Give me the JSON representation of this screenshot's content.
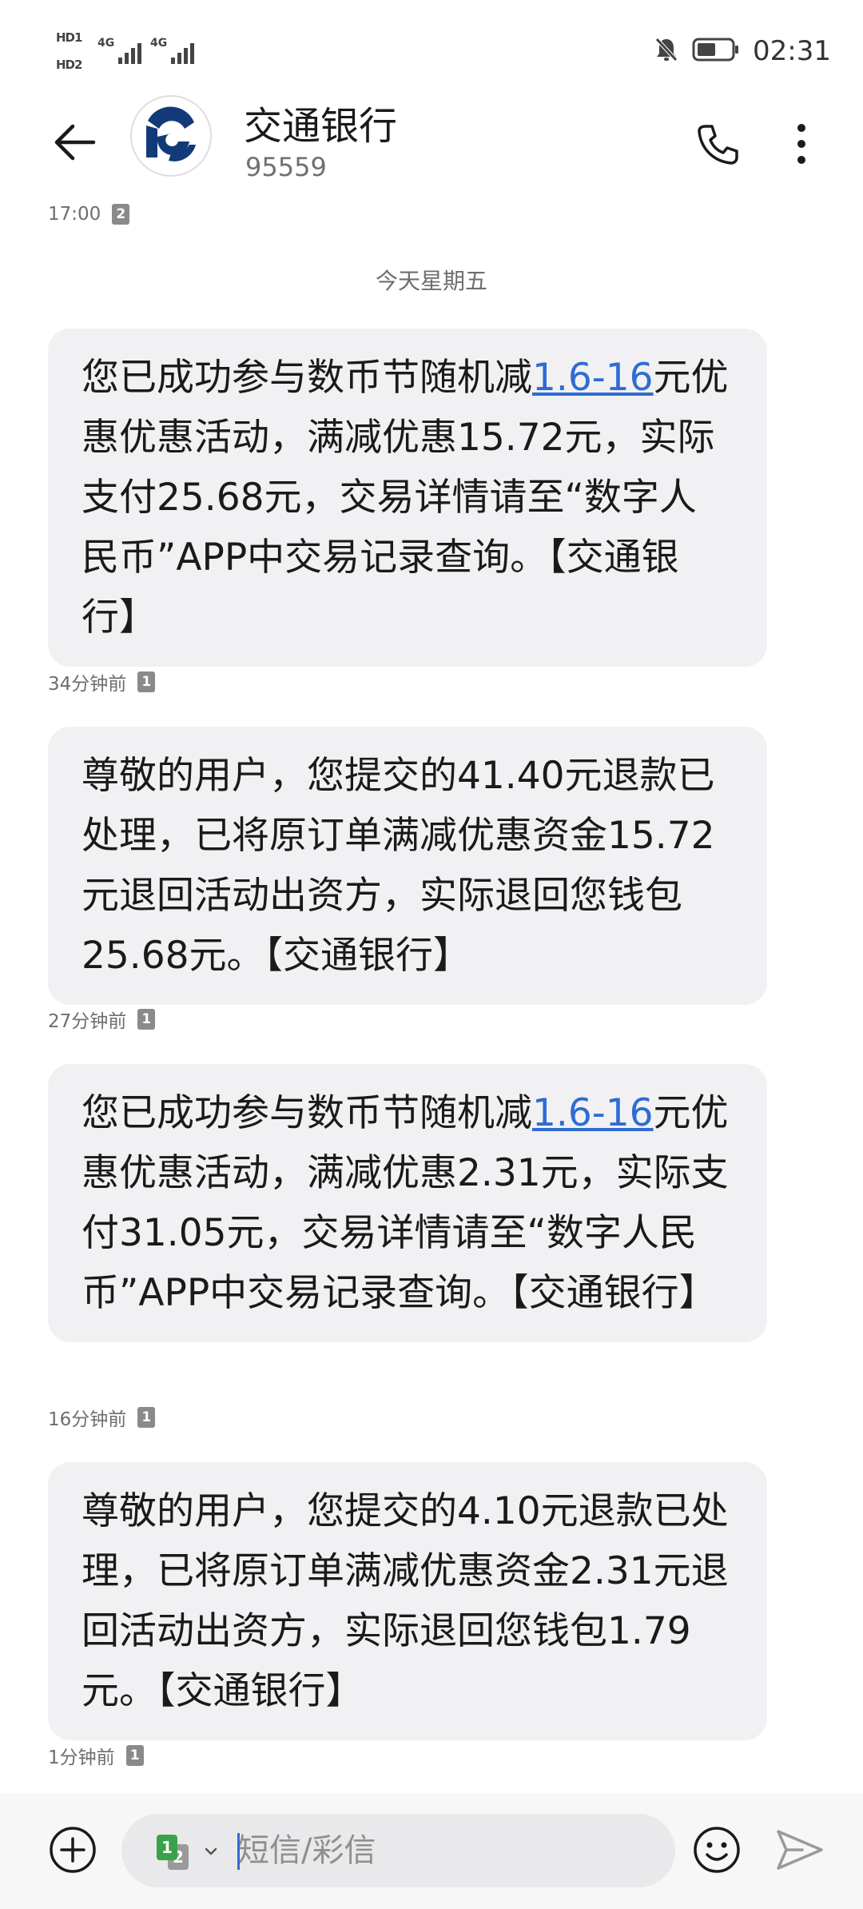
{
  "status_bar": {
    "hd1": "HD1",
    "hd2": "HD2",
    "net1": "4G",
    "net2": "4G",
    "time": "02:31"
  },
  "header": {
    "title": "交通银行",
    "subtitle": "95559"
  },
  "conversation": {
    "prev_meta": {
      "time": "17:00",
      "sim": "2"
    },
    "day_separator": "今天星期五",
    "messages": [
      {
        "pre": "您已成功参与数币节随机减",
        "link": "1.6-16",
        "post": "元优惠优惠活动，满减优惠15.72元，实际支付25.68元，交易详情请至“数字人民币”APP中交易记录查询。【交通银行】",
        "time": "34分钟前",
        "sim": "1"
      },
      {
        "text": "尊敬的用户，您提交的41.40元退款已处理，已将原订单满减优惠资金15.72元退回活动出资方，实际退回您钱包25.68元。【交通银行】",
        "time": "27分钟前",
        "sim": "1"
      },
      {
        "pre": "您已成功参与数币节随机减",
        "link": "1.6-16",
        "post": "元优惠优惠活动，满减优惠2.31元，实际支付31.05元，交易详情请至“数字人民币”APP中交易记录查询。【交通银行】",
        "time": "16分钟前",
        "sim": "1"
      },
      {
        "text": "尊敬的用户，您提交的4.10元退款已处理，已将原订单满减优惠资金2.31元退回活动出资方，实际退回您钱包1.79元。【交通银行】",
        "time": "1分钟前",
        "sim": "1"
      }
    ]
  },
  "composer": {
    "sim_primary": "1",
    "sim_secondary": "2",
    "placeholder": "短信/彩信"
  },
  "icons": {
    "back": "back-arrow-icon",
    "call": "phone-icon",
    "more": "more-vertical-icon",
    "plus": "plus-circle-icon",
    "emoji": "emoji-icon",
    "send": "send-icon",
    "mute": "bell-off-icon",
    "battery": "battery-icon",
    "avatar": "bank-logo-icon"
  },
  "colors": {
    "bubble": "#f1f1f3",
    "link": "#2f6bd2",
    "brand": "#123a78",
    "sim1": "#3aa24a"
  }
}
